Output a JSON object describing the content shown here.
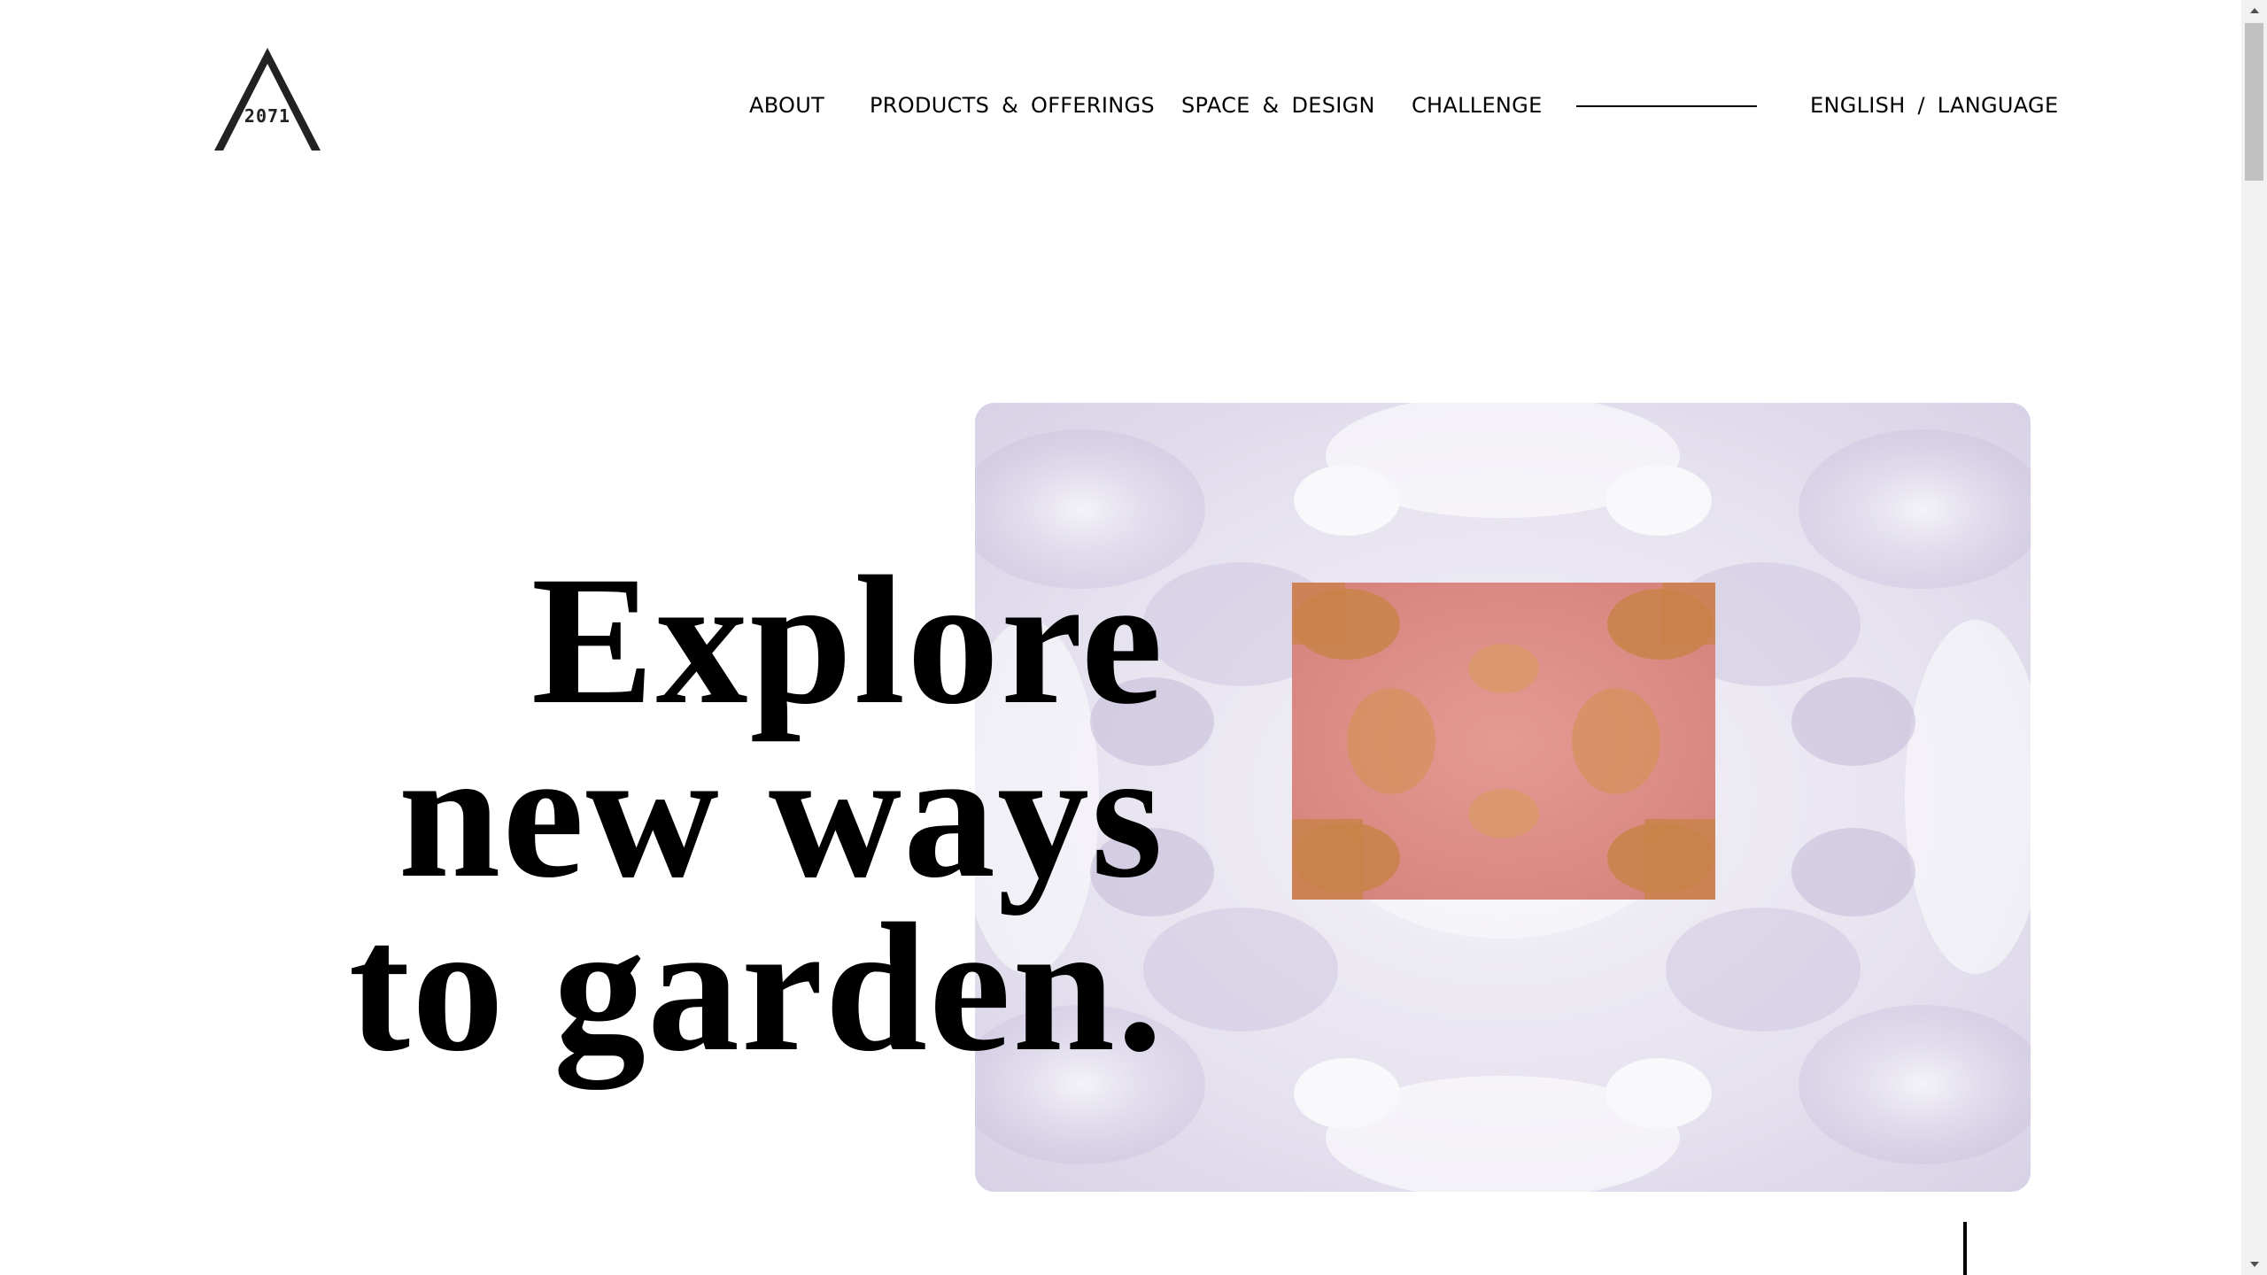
{
  "logo": {
    "text": "2071",
    "icon": "triangle-logo-icon"
  },
  "nav": {
    "items": [
      {
        "label": "ABOUT"
      },
      {
        "label": "PRODUCTS & OFFERINGS"
      },
      {
        "label": "SPACE & DESIGN"
      },
      {
        "label": "CHALLENGE"
      }
    ],
    "language": "ENGLISH / LANGUAGE"
  },
  "hero": {
    "title_lines": [
      "Explore",
      "new ways",
      "to garden."
    ],
    "image_icon": "crystal-kaleidoscope-image"
  },
  "colors": {
    "background": "#ffffff",
    "text": "#000000",
    "image_lavender": "#d9d3e8",
    "overlay_pink": "#dc8a86",
    "overlay_orange": "#cc8a4e"
  }
}
